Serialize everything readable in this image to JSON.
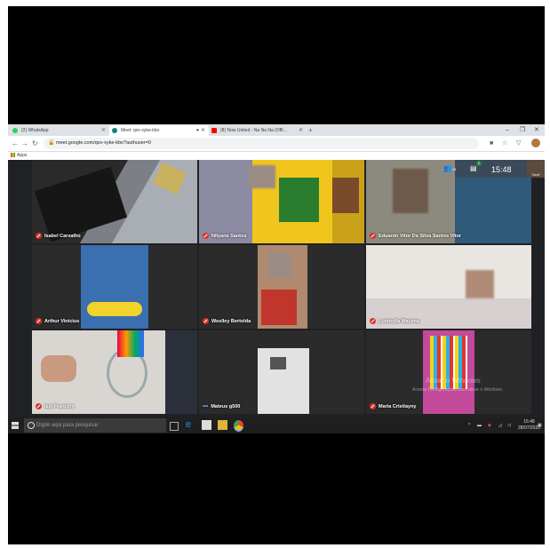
{
  "browser": {
    "tabs": [
      {
        "title": "(2) WhatsApp",
        "color": "#25d366"
      },
      {
        "title": "Meet: qxv-xyke-kbo",
        "color": "#00897b"
      },
      {
        "title": "(8) Now United - Na Na Na (Offi...",
        "color": "#ff0000"
      }
    ],
    "new_tab": "+",
    "window_controls": [
      "–",
      "❐",
      "✕"
    ],
    "url": "meet.google.com/qxv-xyke-kbo?authuser=0",
    "bookmarks_label": "Apps"
  },
  "meet": {
    "participants_count": "24",
    "chat_badge": "2",
    "clock": "15:48",
    "self_label": "Você",
    "tiles": [
      {
        "name": "Isabel Carvalho",
        "muted": true
      },
      {
        "name": "Nilyane Santos",
        "muted": true
      },
      {
        "name": "Eduardo Vitor Da Silva Santos Vitor",
        "muted": true
      },
      {
        "name": "Arthur Vinicius",
        "muted": true
      },
      {
        "name": "Weslley Bertolda",
        "muted": true
      },
      {
        "name": "Ludmylla Macena",
        "muted": true
      },
      {
        "name": "Isis Franciny",
        "muted": true
      },
      {
        "name": "Mateus g500",
        "muted": false
      },
      {
        "name": "Maria Cristlayny",
        "muted": true
      }
    ],
    "watermark_title": "Ativar o Windows",
    "watermark_sub": "Acesse Configurações para ativar o Windows."
  },
  "taskbar": {
    "search_placeholder": "Digite aqui para pesquisar",
    "time": "15:48",
    "date": "28/07/2020"
  }
}
